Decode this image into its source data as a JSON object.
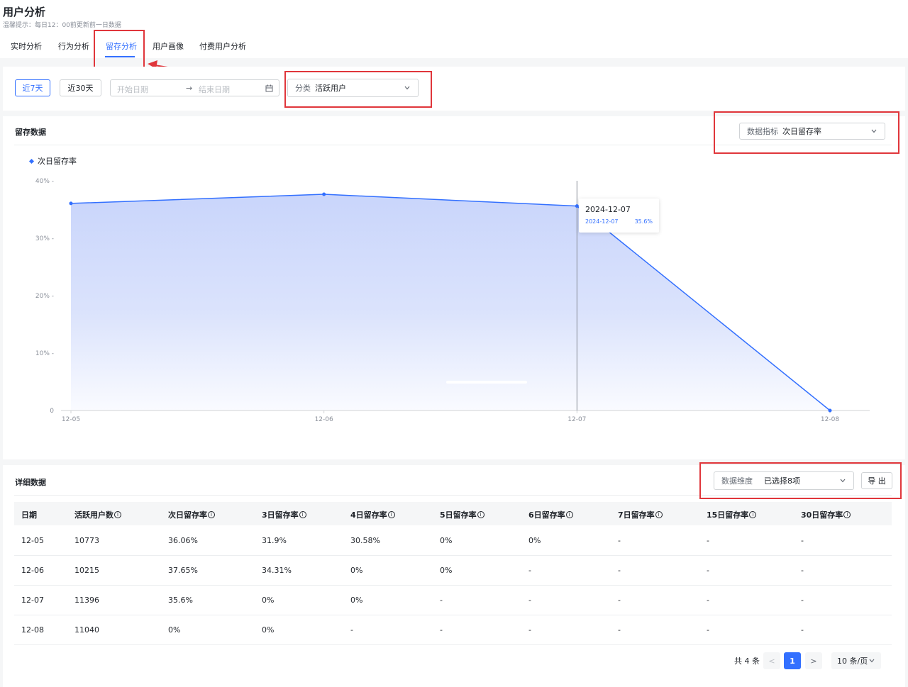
{
  "header": {
    "title": "用户分析",
    "tip": "温馨提示：每日12：00前更新前一日数据",
    "tabs": [
      "实时分析",
      "行为分析",
      "留存分析",
      "用户画像",
      "付费用户分析"
    ],
    "active_tab": "留存分析"
  },
  "filters": {
    "range_7": "近7天",
    "range_30": "近30天",
    "start_placeholder": "开始日期",
    "end_placeholder": "结束日期",
    "range_arrow": "→",
    "category_label": "分类",
    "category_value": "活跃用户"
  },
  "chart_section": {
    "title": "留存数据",
    "metric_label": "数据指标",
    "metric_value": "次日留存率",
    "tooltip": {
      "title": "2024-12-07",
      "name": "2024-12-07",
      "value": "35.6%"
    }
  },
  "chart_data": {
    "type": "area",
    "title": "",
    "xlabel": "",
    "ylabel": "",
    "categories": [
      "12-05",
      "12-06",
      "12-07",
      "12-08"
    ],
    "series": [
      {
        "name": "次日留存率",
        "values": [
          36.06,
          37.65,
          35.6,
          0
        ]
      }
    ],
    "y_ticks": [
      "0",
      "10% -",
      "20% -",
      "30% -",
      "40% -"
    ],
    "ylim": [
      0,
      40
    ],
    "line_color": "#3370ff",
    "fill_color": "#c9d5fb",
    "legend_position": "top-left",
    "grid": false
  },
  "table_section": {
    "title": "详细数据",
    "dimension_label": "数据维度",
    "dimension_value": "已选择8项",
    "export_label": "导 出",
    "columns": [
      "日期",
      "活跃用户数",
      "次日留存率",
      "3日留存率",
      "4日留存率",
      "5日留存率",
      "6日留存率",
      "7日留存率",
      "15日留存率",
      "30日留存率"
    ],
    "rows": [
      [
        "12-05",
        "10773",
        "36.06%",
        "31.9%",
        "30.58%",
        "0%",
        "0%",
        "-",
        "-",
        "-"
      ],
      [
        "12-06",
        "10215",
        "37.65%",
        "34.31%",
        "0%",
        "0%",
        "-",
        "-",
        "-",
        "-"
      ],
      [
        "12-07",
        "11396",
        "35.6%",
        "0%",
        "0%",
        "-",
        "-",
        "-",
        "-",
        "-"
      ],
      [
        "12-08",
        "11040",
        "0%",
        "0%",
        "-",
        "-",
        "-",
        "-",
        "-",
        "-"
      ]
    ]
  },
  "pagination": {
    "total": "共 4 条",
    "current_page": "1",
    "prev": "<",
    "next": ">",
    "page_size": "10 条/页"
  },
  "colors": {
    "accent": "#3370ff",
    "annotation": "#e0363b"
  }
}
